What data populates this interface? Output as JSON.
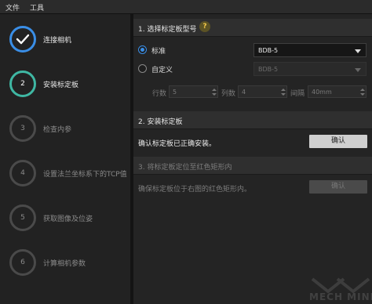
{
  "menubar": {
    "items": [
      "文件",
      "工具"
    ]
  },
  "steps": [
    {
      "number": "",
      "label": "连接相机",
      "state": "done"
    },
    {
      "number": "2",
      "label": "安装标定板",
      "state": "active"
    },
    {
      "number": "3",
      "label": "检查内参",
      "state": "pending"
    },
    {
      "number": "4",
      "label": "设置法兰坐标系下的TCP值",
      "state": "pending"
    },
    {
      "number": "5",
      "label": "获取图像及位姿",
      "state": "pending"
    },
    {
      "number": "6",
      "label": "计算相机参数",
      "state": "pending"
    }
  ],
  "section1": {
    "title": "1. 选择标定板型号",
    "help_icon": "?",
    "options": [
      {
        "label": "标准",
        "checked": true,
        "select_value": "BDB-5",
        "enabled": true
      },
      {
        "label": "自定义",
        "checked": false,
        "select_value": "BDB-5",
        "enabled": false
      }
    ],
    "params": {
      "rows_label": "行数",
      "rows_value": "5",
      "cols_label": "列数",
      "cols_value": "4",
      "spacing_label": "间隔",
      "spacing_value": "40mm"
    }
  },
  "section2": {
    "title": "2. 安装标定板",
    "row_text": "确认标定板已正确安装。",
    "button_label": "确认"
  },
  "section3": {
    "title": "3. 将标定板定位至红色矩形内",
    "row_text": "确保标定板位于右图的红色矩形内。",
    "button_label": "确认"
  },
  "watermark": {
    "text": "MECH MIND"
  },
  "colors": {
    "accent_blue": "#3a8ee6",
    "accent_teal": "#3fb7a3",
    "help_yellow": "#f3c94a"
  }
}
